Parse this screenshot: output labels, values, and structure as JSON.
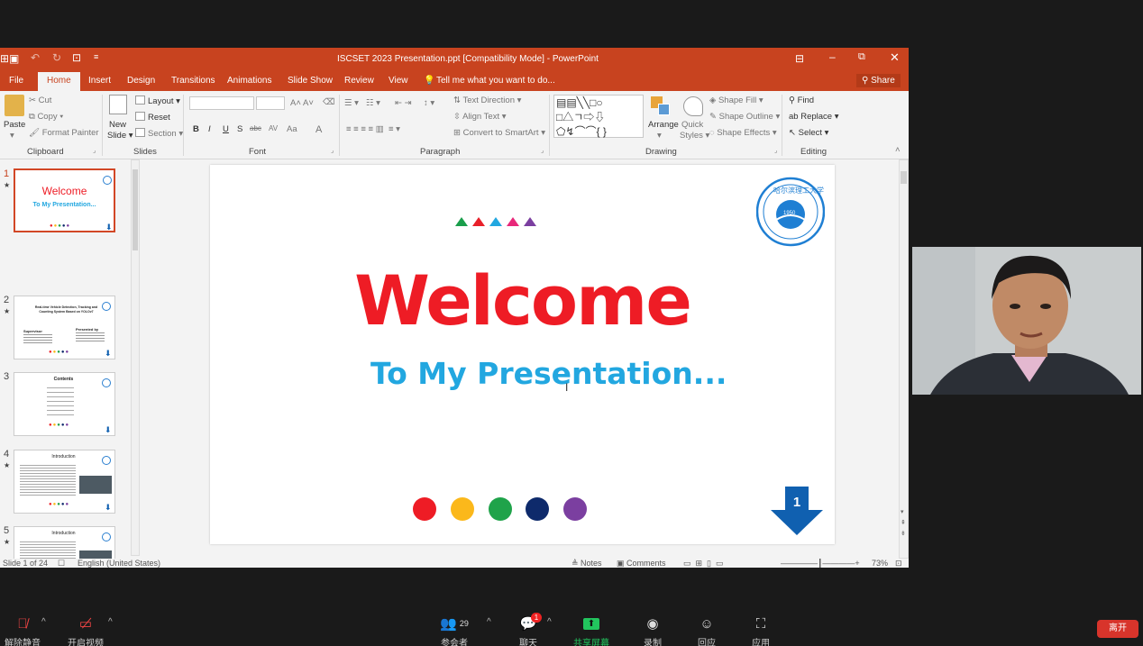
{
  "ppt": {
    "window_title": "ISCSET 2023 Presentation.ppt [Compatibility Mode] - PowerPoint",
    "tabs": [
      "File",
      "Home",
      "Insert",
      "Design",
      "Transitions",
      "Animations",
      "Slide Show",
      "Review",
      "View"
    ],
    "tell_me": "Tell me what you want to do...",
    "share": "Share",
    "ribbon": {
      "clipboard": {
        "paste": "Paste",
        "cut": "Cut",
        "copy": "Copy",
        "format_painter": "Format Painter",
        "label": "Clipboard"
      },
      "slides": {
        "new_slide_1": "New",
        "new_slide_2": "Slide",
        "layout": "Layout",
        "reset": "Reset",
        "section": "Section",
        "label": "Slides"
      },
      "font": {
        "label": "Font",
        "bold": "B",
        "italic": "I",
        "underline": "U",
        "shadow": "S",
        "strike": "abc",
        "spacing": "AV",
        "case": "Aa",
        "color": "A"
      },
      "paragraph": {
        "text_direction": "Text Direction",
        "align_text": "Align Text",
        "smartart": "Convert to SmartArt",
        "label": "Paragraph"
      },
      "drawing": {
        "arrange": "Arrange",
        "quick_styles_1": "Quick",
        "quick_styles_2": "Styles",
        "shape_fill": "Shape Fill",
        "shape_outline": "Shape Outline",
        "shape_effects": "Shape Effects",
        "label": "Drawing"
      },
      "editing": {
        "find": "Find",
        "replace": "Replace",
        "select": "Select",
        "label": "Editing"
      }
    },
    "thumbnails": [
      {
        "num": "1",
        "title": "Welcome",
        "subtitle": "To My Presentation..."
      },
      {
        "num": "2",
        "title": "Real-time Vehicle Detection, Tracking and Counting System Based on YOLOv7",
        "left_head": "Supervisor",
        "right_head": "Presented by"
      },
      {
        "num": "3",
        "title": "Contents"
      },
      {
        "num": "4",
        "title": "Introduction"
      },
      {
        "num": "5",
        "title": "Introduction"
      }
    ],
    "slide": {
      "title": "Welcome",
      "subtitle": "To My Presentation...",
      "page_number": "1",
      "seal_year": "1950",
      "triangle_colors": [
        "#1a9e4b",
        "#e8202a",
        "#22a7e0",
        "#e8287a",
        "#7b3fa0"
      ],
      "dot_colors": [
        "#ee1c25",
        "#fbb81b",
        "#1fa34a",
        "#0e2a6b",
        "#7b3fa0"
      ]
    },
    "status": {
      "slide_of": "Slide 1 of 24",
      "language": "English (United States)",
      "notes": "Notes",
      "comments": "Comments",
      "zoom": "73%"
    }
  },
  "meeting": {
    "unmute": "解除静音",
    "start_video": "开启视频",
    "participants_label": "参会者",
    "participants_count": "29",
    "chat_label": "聊天",
    "chat_badge": "1",
    "share_label": "共享屏幕",
    "record_label": "录制",
    "reactions_label": "回应",
    "apps_label": "应用",
    "leave": "离开"
  }
}
